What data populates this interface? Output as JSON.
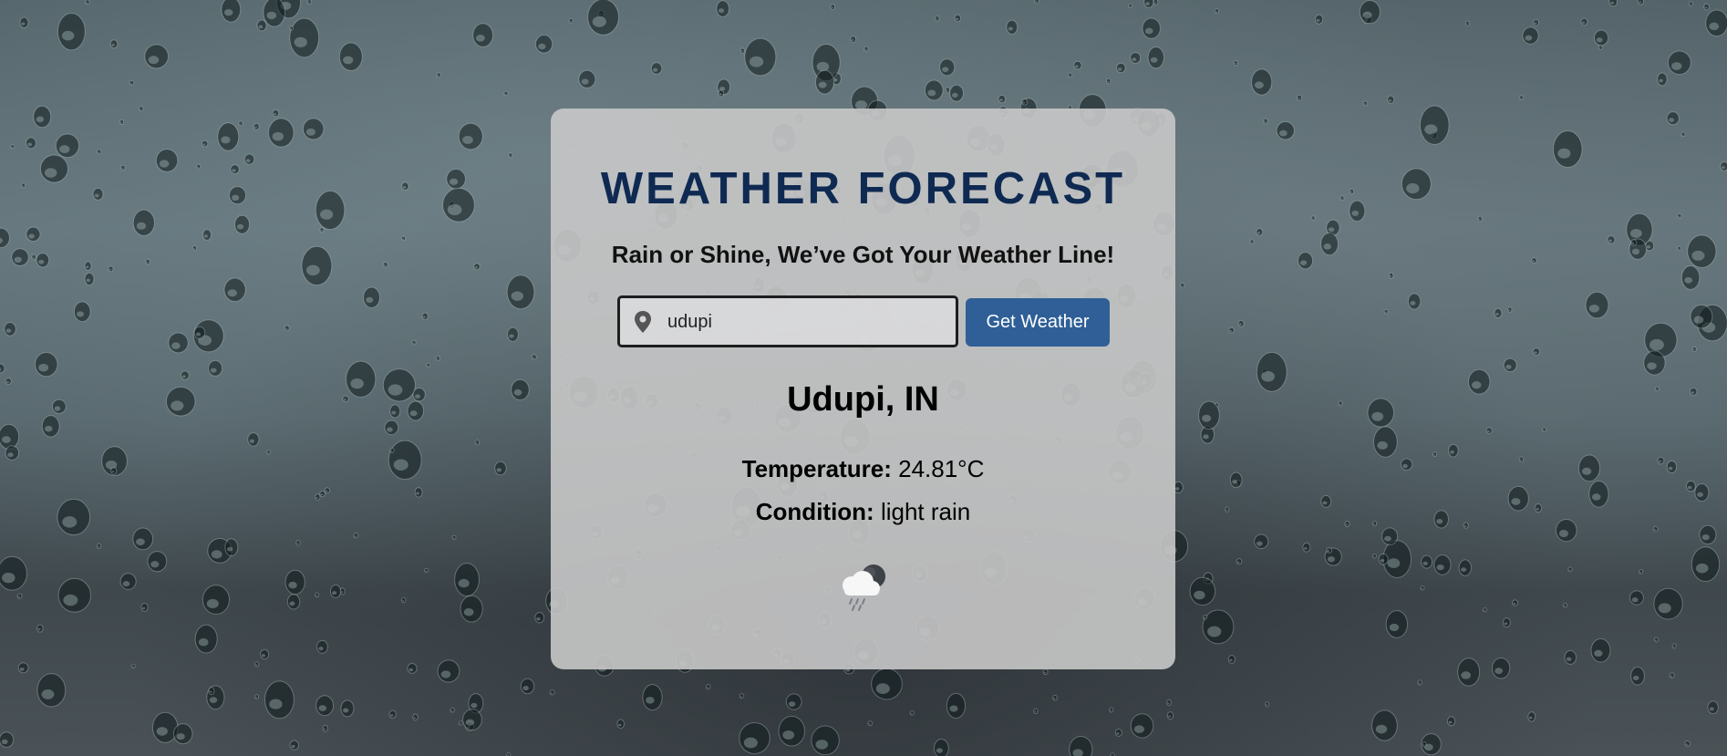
{
  "app": {
    "title": "WEATHER FORECAST",
    "tagline": "Rain or Shine, We’ve Got Your Weather Line!"
  },
  "search": {
    "value": "udupi",
    "icon": "location-pin-icon",
    "button_label": "Get Weather"
  },
  "result": {
    "city": "Udupi, IN",
    "temperature_label": "Temperature:",
    "temperature_value": "24.81°C",
    "condition_label": "Condition:",
    "condition_value": "light rain",
    "icon": "rain-cloud-icon"
  },
  "colors": {
    "title": "#0f2a52",
    "button": "#2f5f96",
    "card": "#c8c8c8"
  }
}
